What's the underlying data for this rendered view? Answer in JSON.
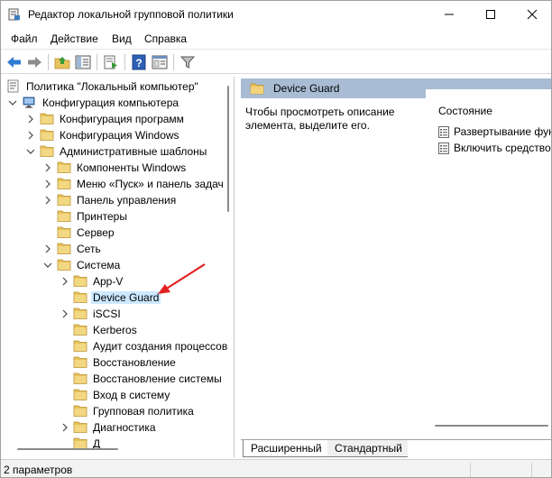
{
  "window": {
    "title": "Редактор локальной групповой политики"
  },
  "menu": [
    "Файл",
    "Действие",
    "Вид",
    "Справка"
  ],
  "toolbar": {
    "icons": [
      "back-arrow-icon",
      "forward-arrow-icon",
      "up-folder-icon",
      "show-hide-tree-icon",
      "export-list-icon",
      "help-icon",
      "properties-icon",
      "filter-icon"
    ]
  },
  "tree": {
    "items": [
      {
        "label": "Политика \"Локальный компьютер\"",
        "level": 0,
        "arrow": "none",
        "icon": "policy"
      },
      {
        "label": "Конфигурация компьютера",
        "level": 1,
        "arrow": "expanded",
        "icon": "computer"
      },
      {
        "label": "Конфигурация программ",
        "level": 2,
        "arrow": "collapsed",
        "icon": "folder"
      },
      {
        "label": "Конфигурация Windows",
        "level": 2,
        "arrow": "collapsed",
        "icon": "folder"
      },
      {
        "label": "Административные шаблоны",
        "level": 2,
        "arrow": "expanded",
        "icon": "folder"
      },
      {
        "label": "Компоненты Windows",
        "level": 3,
        "arrow": "collapsed",
        "icon": "folder"
      },
      {
        "label": "Меню «Пуск» и панель задач",
        "level": 3,
        "arrow": "collapsed",
        "icon": "folder"
      },
      {
        "label": "Панель управления",
        "level": 3,
        "arrow": "collapsed",
        "icon": "folder"
      },
      {
        "label": "Принтеры",
        "level": 3,
        "arrow": "none",
        "icon": "folder"
      },
      {
        "label": "Сервер",
        "level": 3,
        "arrow": "none",
        "icon": "folder"
      },
      {
        "label": "Сеть",
        "level": 3,
        "arrow": "collapsed",
        "icon": "folder"
      },
      {
        "label": "Система",
        "level": 3,
        "arrow": "expanded",
        "icon": "folder"
      },
      {
        "label": "App-V",
        "level": 4,
        "arrow": "collapsed",
        "icon": "folder"
      },
      {
        "label": "Device Guard",
        "level": 4,
        "arrow": "none",
        "icon": "folder",
        "selected": true
      },
      {
        "label": "iSCSI",
        "level": 4,
        "arrow": "collapsed",
        "icon": "folder"
      },
      {
        "label": "Kerberos",
        "level": 4,
        "arrow": "none",
        "icon": "folder"
      },
      {
        "label": "Аудит создания процессов",
        "level": 4,
        "arrow": "none",
        "icon": "folder"
      },
      {
        "label": "Восстановление",
        "level": 4,
        "arrow": "none",
        "icon": "folder"
      },
      {
        "label": "Восстановление системы",
        "level": 4,
        "arrow": "none",
        "icon": "folder"
      },
      {
        "label": "Вход в систему",
        "level": 4,
        "arrow": "none",
        "icon": "folder"
      },
      {
        "label": "Групповая политика",
        "level": 4,
        "arrow": "none",
        "icon": "folder"
      },
      {
        "label": "Диагностика",
        "level": 4,
        "arrow": "collapsed",
        "icon": "folder"
      },
      {
        "label": "Д",
        "level": 4,
        "arrow": "none",
        "icon": "folder"
      }
    ]
  },
  "right": {
    "header": "Device Guard",
    "description": "Чтобы просмотреть описание элемента, выделите его.",
    "column_header": "Состояние",
    "items": [
      "Развертывание фун",
      "Включить средство"
    ]
  },
  "tabs": [
    "Расширенный",
    "Стандартный"
  ],
  "status": "2 параметров",
  "colors": {
    "header_bg": "#a8bdd4",
    "selection": "#cce8ff",
    "folder": "#e8c25a",
    "annotation": "#e02020"
  }
}
